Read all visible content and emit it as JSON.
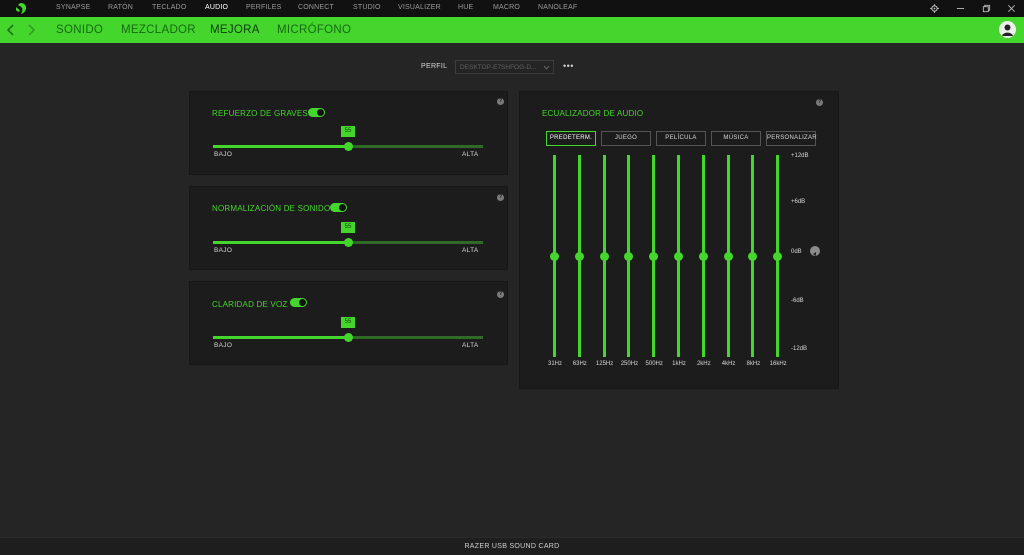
{
  "topnav": {
    "items": [
      "SYNAPSE",
      "RATÓN",
      "TECLADO",
      "AUDIO",
      "PERFILES",
      "CONNECT",
      "STUDIO",
      "VISUALIZER",
      "HUE",
      "MACRO",
      "NANOLEAF"
    ],
    "active": "AUDIO"
  },
  "subnav": {
    "items": [
      "SONIDO",
      "MEZCLADOR",
      "MEJORA",
      "MICRÓFONO"
    ],
    "active": "MEJORA"
  },
  "profile": {
    "label": "PERFIL",
    "value": "DESKTOP-E7SHFOG-D...",
    "more": "•••"
  },
  "enhancements": [
    {
      "title": "REFUERZO DE GRAVES",
      "enabled": true,
      "value": "55",
      "value_fraction": 0.5,
      "min_label": "BAJO",
      "max_label": "ALTA"
    },
    {
      "title": "NORMALIZACIÓN DE SONIDO",
      "enabled": true,
      "value": "55",
      "value_fraction": 0.5,
      "min_label": "BAJO",
      "max_label": "ALTA"
    },
    {
      "title": "CLARIDAD DE VOZ",
      "enabled": true,
      "value": "55",
      "value_fraction": 0.5,
      "min_label": "BAJO",
      "max_label": "ALTA"
    }
  ],
  "equalizer": {
    "title": "ECUALIZADOR DE AUDIO",
    "presets": [
      "PREDETERM.",
      "JUEGO",
      "PELÍCULA",
      "MÚSICA",
      "PERSONALIZAR"
    ],
    "active_preset": "PREDETERM.",
    "bands": [
      "31Hz",
      "63Hz",
      "125Hz",
      "250Hz",
      "500Hz",
      "1kHz",
      "2kHz",
      "4kHz",
      "8kHz",
      "16kHz"
    ],
    "band_values_db": [
      0,
      0,
      0,
      0,
      0,
      0,
      0,
      0,
      0,
      0
    ],
    "db_labels": [
      "+12dB",
      "+6dB",
      "0dB",
      "-6dB",
      "-12dB"
    ]
  },
  "footer": {
    "device": "RAZER USB SOUND CARD"
  },
  "colors": {
    "accent": "#44d62c",
    "background": "#252525",
    "panel": "#1c1c1c"
  }
}
